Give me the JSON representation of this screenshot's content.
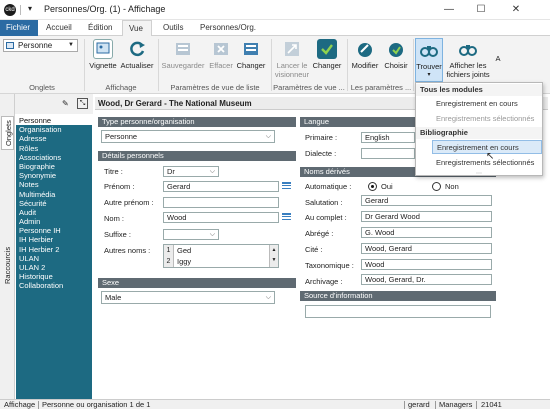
{
  "window": {
    "app_icon": "ckd",
    "title": "Personnes/Org. (1) - Affichage",
    "minimize": "—",
    "maximize": "☐",
    "close": "✕"
  },
  "tabs": [
    "Fichier",
    "Accueil",
    "Édition",
    "Vue",
    "Outils",
    "Personnes/Org."
  ],
  "ribbon": {
    "selector_value": "Personne",
    "group_onglets": "Onglets",
    "btn_vignette": "Vignette",
    "btn_actualiser": "Actualiser",
    "group_affichage": "Affichage",
    "btn_sauvegarder": "Sauvegarder",
    "btn_effacer": "Effacer",
    "btn_changer1": "Changer",
    "group_params_liste": "Paramètres de vue de liste",
    "btn_lancer_line1": "Lancer le",
    "btn_lancer_line2": "visionneur",
    "btn_changer2": "Changer",
    "group_params_vue": "Paramètres de vue ...",
    "btn_modifier": "Modifier",
    "btn_choisir": "Choisir",
    "group_params": "Les paramètres ...",
    "btn_trouver": "Trouver",
    "btn_afficher_line1": "Afficher les",
    "btn_afficher_line2": "fichiers joints",
    "overflow": "A"
  },
  "rail": {
    "tab_onglets": "Onglets",
    "tab_raccourcis": "Raccourcis"
  },
  "nav": {
    "items": [
      "Personne",
      "Organisation",
      "Adresse",
      "Rôles",
      "Associations",
      "Biographie",
      "Synonymie",
      "Notes",
      "Multimédia",
      "Sécurité",
      "Audit",
      "Admin",
      "Personne IH",
      "IH Herbier",
      "IH Herbier 2",
      "ULAN",
      "ULAN 2",
      "Historique",
      "Collaboration"
    ],
    "selected_index": 0
  },
  "record": {
    "header": "Wood, Dr Gerard - The National Museum",
    "type_section": "Type personne/organisation",
    "type_value": "Personne",
    "details_section": "Détails personnels",
    "titre_label": "Titre :",
    "titre_value": "Dr",
    "prenom_label": "Prénom :",
    "prenom_value": "Gerard",
    "autre_prenom_label": "Autre prénom :",
    "autre_prenom_value": "",
    "nom_label": "Nom :",
    "nom_value": "Wood",
    "suffixe_label": "Suffixe :",
    "suffixe_value": "",
    "autres_noms_label": "Autres noms :",
    "autres_noms": [
      {
        "num": "1",
        "name": "Ged"
      },
      {
        "num": "2",
        "name": "Iggy"
      }
    ],
    "sexe_section": "Sexe",
    "sexe_value": "Male",
    "langue_section": "Langue",
    "primaire_label": "Primaire :",
    "primaire_value": "English",
    "dialecte_label": "Dialecte :",
    "dialecte_value": "",
    "noms_derives_section": "Noms dérivés",
    "automatique_label": "Automatique :",
    "radio_oui": "Oui",
    "radio_non": "Non",
    "automatique_value": "Oui",
    "salutation_label": "Salutation :",
    "salutation_value": "Gerard",
    "au_complet_label": "Au complet :",
    "au_complet_value": "Dr Gerard Wood",
    "abrege_label": "Abrégé :",
    "abrege_value": "G. Wood",
    "cite_label": "Cité :",
    "cite_value": "Wood, Gerard",
    "taxonomique_label": "Taxonomique :",
    "taxonomique_value": "Wood",
    "archivage_label": "Archivage :",
    "archivage_value": "Wood, Gerard, Dr.",
    "source_section": "Source d'information",
    "source_value": ""
  },
  "dropdown": {
    "heading1": "Tous les modules",
    "item1": "Enregistrement en cours",
    "item2": "Enregistrements sélectionnés",
    "heading2": "Bibliographie",
    "item3": "Enregistrement en cours",
    "item4": "Enregistrements sélectionnés",
    "highlighted": "Bibliographie / Enregistrement en cours"
  },
  "status": {
    "mode": "Affichage",
    "record_info": "Personne ou organisation 1 de 1",
    "user": "gerard",
    "group": "Managers",
    "count": "21041"
  },
  "colors": {
    "file_tab": "#2b6ba3",
    "nav_bg": "#1d6a82",
    "section_head": "#5f6a72",
    "menu_highlight": "#dbeaf8"
  }
}
